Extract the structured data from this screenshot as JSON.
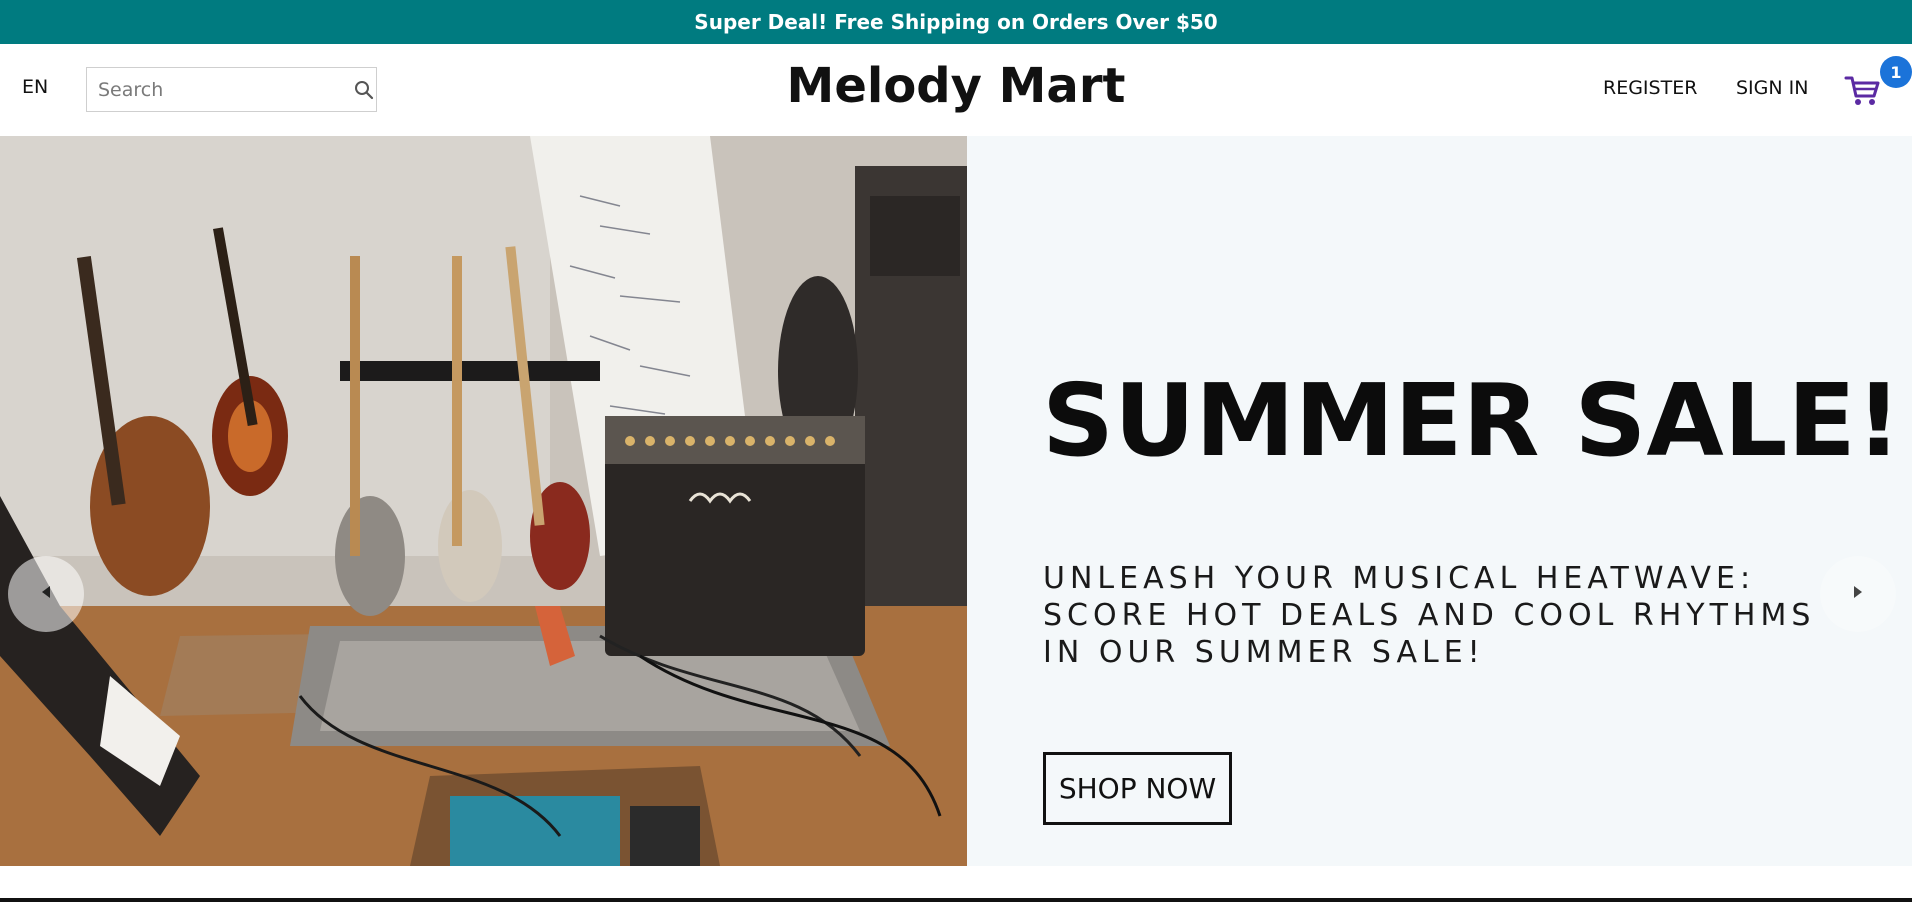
{
  "promo": {
    "text": "Super Deal! Free Shipping on Orders Over $50"
  },
  "header": {
    "language": "EN",
    "search": {
      "placeholder": "Search",
      "value": ""
    },
    "brand": "Melody Mart",
    "register_label": "REGISTER",
    "signin_label": "SIGN IN",
    "cart_count": "1",
    "icons": {
      "search": "search-icon",
      "cart": "shopping-cart-icon"
    }
  },
  "hero": {
    "headline": "SUMMER SALE!",
    "subhead": "UNLEASH YOUR MUSICAL HEATWAVE: SCORE HOT DEALS AND COOL RHYTHMS IN OUR SUMMER SALE!",
    "cta_label": "SHOP NOW",
    "image_alt": "guitars-and-amplifier-room-photo"
  },
  "colors": {
    "promo_bg": "#007b80",
    "cart_icon": "#5b2aa3",
    "badge_bg": "#1b73d9",
    "hero_bg": "#f4f8fa"
  }
}
